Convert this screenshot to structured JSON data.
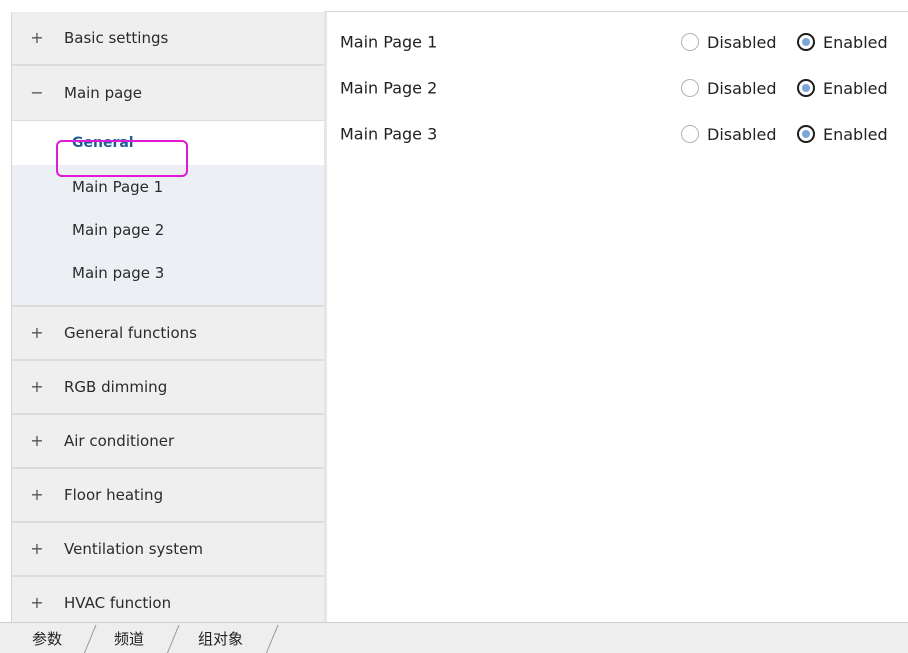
{
  "sidebar": {
    "sections_top": [
      {
        "sign": "+",
        "label": "Basic settings"
      },
      {
        "sign": "−",
        "label": "Main page"
      }
    ],
    "subitems": [
      {
        "label": "General",
        "active": true
      },
      {
        "label": "Main Page 1"
      },
      {
        "label": "Main page 2"
      },
      {
        "label": "Main page 3"
      }
    ],
    "sections_bottom": [
      {
        "sign": "+",
        "label": "General functions"
      },
      {
        "sign": "+",
        "label": "RGB dimming"
      },
      {
        "sign": "+",
        "label": "Air conditioner"
      },
      {
        "sign": "+",
        "label": "Floor heating"
      },
      {
        "sign": "+",
        "label": "Ventilation system"
      },
      {
        "sign": "+",
        "label": "HVAC function"
      }
    ]
  },
  "main": {
    "params": [
      {
        "label": "Main Page 1",
        "options": [
          "Disabled",
          "Enabled"
        ],
        "selected": "Enabled"
      },
      {
        "label": "Main Page 2",
        "options": [
          "Disabled",
          "Enabled"
        ],
        "selected": "Enabled"
      },
      {
        "label": "Main Page 3",
        "options": [
          "Disabled",
          "Enabled"
        ],
        "selected": "Enabled"
      }
    ]
  },
  "tabs": [
    "参数",
    "频道",
    "组对象"
  ],
  "colors": {
    "highlight": "#e01bd6",
    "active_text": "#1e5f99",
    "radio_fill": "#7aa6d8"
  }
}
